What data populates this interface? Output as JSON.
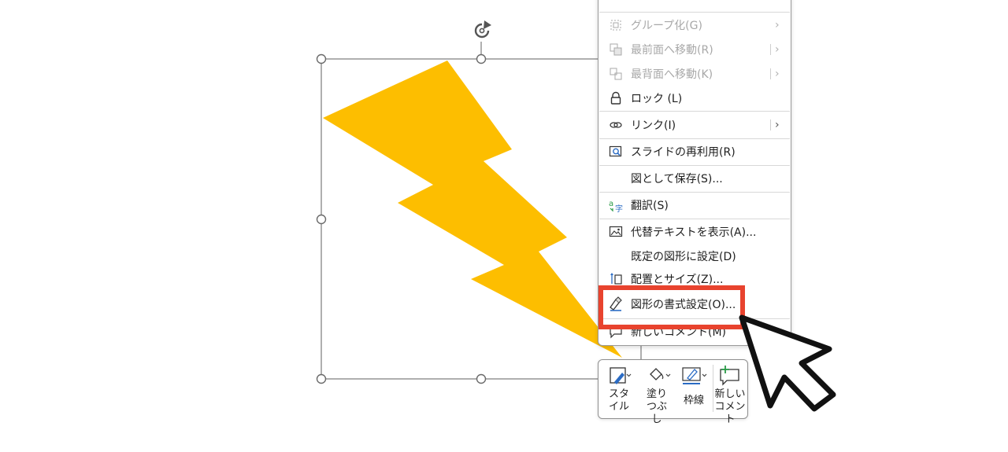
{
  "colors": {
    "shape_fill": "#FDBE00",
    "highlight": "#E8432E",
    "menu_text": "#1E1E1E",
    "menu_disabled": "#A8A8A8",
    "icon_blue": "#2B6CC4",
    "icon_green": "#2A9A47"
  },
  "slide": {
    "shape_name": "lightning-bolt"
  },
  "context_menu": {
    "items": [
      {
        "label": "グループ化(G)",
        "icon": "group-icon",
        "disabled": true,
        "submenu": true
      },
      {
        "label": "最前面へ移動(R)",
        "icon": "bring-to-front-icon",
        "disabled": true,
        "submenu": true
      },
      {
        "label": "最背面へ移動(K)",
        "icon": "send-to-back-icon",
        "disabled": true,
        "submenu": true
      },
      {
        "label": "ロック (L)",
        "icon": "lock-icon",
        "disabled": false,
        "submenu": false
      },
      {
        "label": "リンク(I)",
        "icon": "link-icon",
        "disabled": false,
        "submenu": true
      },
      {
        "label": "スライドの再利用(R)",
        "icon": "reuse-slides-icon",
        "disabled": false,
        "submenu": false
      },
      {
        "label": "図として保存(S)...",
        "icon": "",
        "disabled": false,
        "submenu": false
      },
      {
        "label": "翻訳(S)",
        "icon": "translate-icon",
        "disabled": false,
        "submenu": false
      },
      {
        "label": "代替テキストを表示(A)...",
        "icon": "alt-text-icon",
        "disabled": false,
        "submenu": false
      },
      {
        "label": "既定の図形に設定(D)",
        "icon": "",
        "disabled": false,
        "submenu": false
      },
      {
        "label": "配置とサイズ(Z)...",
        "icon": "size-position-icon",
        "disabled": false,
        "submenu": false
      },
      {
        "label": "図形の書式設定(O)...",
        "icon": "format-shape-icon",
        "disabled": false,
        "submenu": false
      },
      {
        "label": "新しいコメント(M)",
        "icon": "new-comment-icon",
        "disabled": false,
        "submenu": false
      }
    ]
  },
  "mini_toolbar": {
    "style_label": "スタイル",
    "fill_label": "塗りつぶし",
    "outline_label": "枠線",
    "comment_label": "新しいコメント"
  }
}
